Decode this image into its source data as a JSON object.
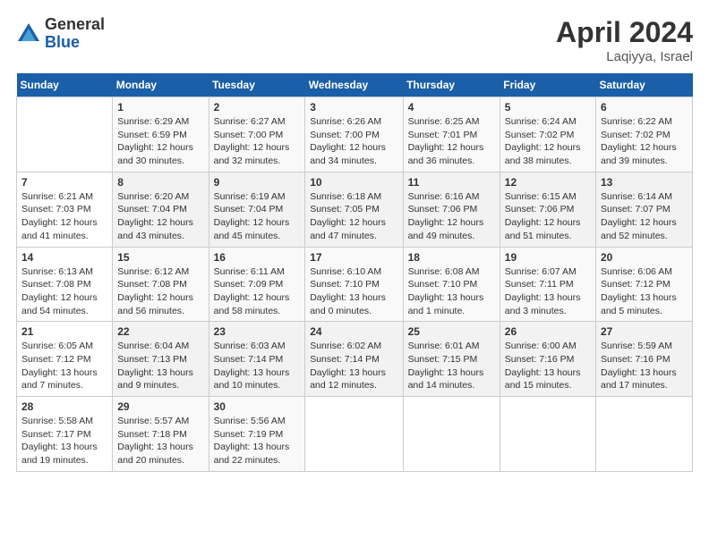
{
  "logo": {
    "general": "General",
    "blue": "Blue"
  },
  "title": "April 2024",
  "location": "Laqiyya, Israel",
  "days_of_week": [
    "Sunday",
    "Monday",
    "Tuesday",
    "Wednesday",
    "Thursday",
    "Friday",
    "Saturday"
  ],
  "weeks": [
    [
      {
        "day": "",
        "info": ""
      },
      {
        "day": "1",
        "info": "Sunrise: 6:29 AM\nSunset: 6:59 PM\nDaylight: 12 hours\nand 30 minutes."
      },
      {
        "day": "2",
        "info": "Sunrise: 6:27 AM\nSunset: 7:00 PM\nDaylight: 12 hours\nand 32 minutes."
      },
      {
        "day": "3",
        "info": "Sunrise: 6:26 AM\nSunset: 7:00 PM\nDaylight: 12 hours\nand 34 minutes."
      },
      {
        "day": "4",
        "info": "Sunrise: 6:25 AM\nSunset: 7:01 PM\nDaylight: 12 hours\nand 36 minutes."
      },
      {
        "day": "5",
        "info": "Sunrise: 6:24 AM\nSunset: 7:02 PM\nDaylight: 12 hours\nand 38 minutes."
      },
      {
        "day": "6",
        "info": "Sunrise: 6:22 AM\nSunset: 7:02 PM\nDaylight: 12 hours\nand 39 minutes."
      }
    ],
    [
      {
        "day": "7",
        "info": "Sunrise: 6:21 AM\nSunset: 7:03 PM\nDaylight: 12 hours\nand 41 minutes."
      },
      {
        "day": "8",
        "info": "Sunrise: 6:20 AM\nSunset: 7:04 PM\nDaylight: 12 hours\nand 43 minutes."
      },
      {
        "day": "9",
        "info": "Sunrise: 6:19 AM\nSunset: 7:04 PM\nDaylight: 12 hours\nand 45 minutes."
      },
      {
        "day": "10",
        "info": "Sunrise: 6:18 AM\nSunset: 7:05 PM\nDaylight: 12 hours\nand 47 minutes."
      },
      {
        "day": "11",
        "info": "Sunrise: 6:16 AM\nSunset: 7:06 PM\nDaylight: 12 hours\nand 49 minutes."
      },
      {
        "day": "12",
        "info": "Sunrise: 6:15 AM\nSunset: 7:06 PM\nDaylight: 12 hours\nand 51 minutes."
      },
      {
        "day": "13",
        "info": "Sunrise: 6:14 AM\nSunset: 7:07 PM\nDaylight: 12 hours\nand 52 minutes."
      }
    ],
    [
      {
        "day": "14",
        "info": "Sunrise: 6:13 AM\nSunset: 7:08 PM\nDaylight: 12 hours\nand 54 minutes."
      },
      {
        "day": "15",
        "info": "Sunrise: 6:12 AM\nSunset: 7:08 PM\nDaylight: 12 hours\nand 56 minutes."
      },
      {
        "day": "16",
        "info": "Sunrise: 6:11 AM\nSunset: 7:09 PM\nDaylight: 12 hours\nand 58 minutes."
      },
      {
        "day": "17",
        "info": "Sunrise: 6:10 AM\nSunset: 7:10 PM\nDaylight: 13 hours\nand 0 minutes."
      },
      {
        "day": "18",
        "info": "Sunrise: 6:08 AM\nSunset: 7:10 PM\nDaylight: 13 hours\nand 1 minute."
      },
      {
        "day": "19",
        "info": "Sunrise: 6:07 AM\nSunset: 7:11 PM\nDaylight: 13 hours\nand 3 minutes."
      },
      {
        "day": "20",
        "info": "Sunrise: 6:06 AM\nSunset: 7:12 PM\nDaylight: 13 hours\nand 5 minutes."
      }
    ],
    [
      {
        "day": "21",
        "info": "Sunrise: 6:05 AM\nSunset: 7:12 PM\nDaylight: 13 hours\nand 7 minutes."
      },
      {
        "day": "22",
        "info": "Sunrise: 6:04 AM\nSunset: 7:13 PM\nDaylight: 13 hours\nand 9 minutes."
      },
      {
        "day": "23",
        "info": "Sunrise: 6:03 AM\nSunset: 7:14 PM\nDaylight: 13 hours\nand 10 minutes."
      },
      {
        "day": "24",
        "info": "Sunrise: 6:02 AM\nSunset: 7:14 PM\nDaylight: 13 hours\nand 12 minutes."
      },
      {
        "day": "25",
        "info": "Sunrise: 6:01 AM\nSunset: 7:15 PM\nDaylight: 13 hours\nand 14 minutes."
      },
      {
        "day": "26",
        "info": "Sunrise: 6:00 AM\nSunset: 7:16 PM\nDaylight: 13 hours\nand 15 minutes."
      },
      {
        "day": "27",
        "info": "Sunrise: 5:59 AM\nSunset: 7:16 PM\nDaylight: 13 hours\nand 17 minutes."
      }
    ],
    [
      {
        "day": "28",
        "info": "Sunrise: 5:58 AM\nSunset: 7:17 PM\nDaylight: 13 hours\nand 19 minutes."
      },
      {
        "day": "29",
        "info": "Sunrise: 5:57 AM\nSunset: 7:18 PM\nDaylight: 13 hours\nand 20 minutes."
      },
      {
        "day": "30",
        "info": "Sunrise: 5:56 AM\nSunset: 7:19 PM\nDaylight: 13 hours\nand 22 minutes."
      },
      {
        "day": "",
        "info": ""
      },
      {
        "day": "",
        "info": ""
      },
      {
        "day": "",
        "info": ""
      },
      {
        "day": "",
        "info": ""
      }
    ]
  ]
}
